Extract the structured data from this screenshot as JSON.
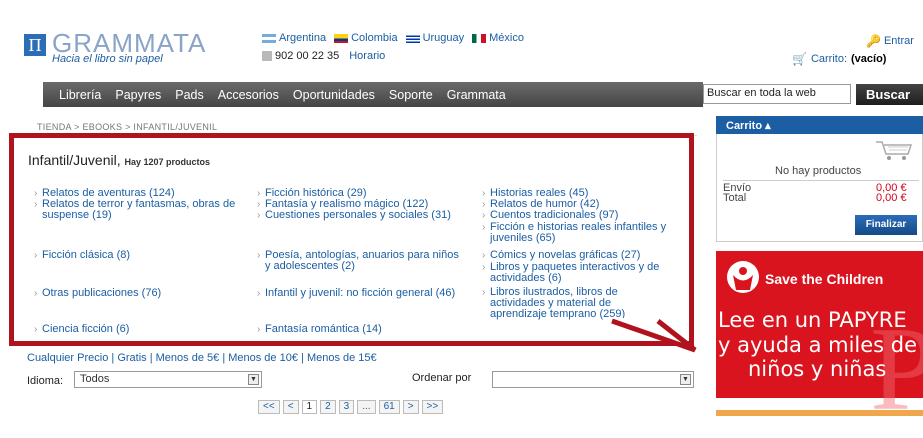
{
  "header": {
    "logo_mark": "Π",
    "logo_text": "GRAMMATA",
    "tagline": "Hacia el libro sin papel",
    "countries": [
      {
        "name": "Argentina",
        "flag_colors": [
          "#74acdf",
          "#ffffff",
          "#74acdf"
        ]
      },
      {
        "name": "Colombia",
        "flag_colors": [
          "#fcd116",
          "#003893",
          "#ce1126"
        ]
      },
      {
        "name": "Uruguay",
        "flag_colors": [
          "#ffffff",
          "#0038a8",
          "#ffffff"
        ]
      },
      {
        "name": "México",
        "flag_colors": [
          "#006847",
          "#ffffff",
          "#ce1126"
        ]
      }
    ],
    "phone": "902 00 22 35",
    "horario": "Horario",
    "entrar": "Entrar",
    "carrito_label": "Carrito:",
    "carrito_status": "(vacío)"
  },
  "nav": {
    "items": [
      "Librería",
      "Papyres",
      "Pads",
      "Accesorios",
      "Oportunidades",
      "Soporte",
      "Grammata"
    ],
    "search_value": "Buscar en toda la web",
    "search_button": "Buscar"
  },
  "breadcrumb": "TIENDA > EBOOKS > INFANTIL/JUVENIL",
  "category": {
    "title": "Infantil/Juvenil,",
    "count": "Hay 1207 productos",
    "col1": [
      "Relatos de aventuras (124)",
      "Relatos de terror y fantasmas, obras de suspense (19)",
      "Ficción clásica (8)",
      "Otras publicaciones (76)",
      "Ciencia ficción (6)"
    ],
    "col2": [
      "Ficción histórica (29)",
      "Fantasía y realismo mágico (122)",
      "Cuestiones personales y sociales (31)",
      "Poesía, antologías, anuarios para niños y adolescentes (2)",
      "Infantil y juvenil: no ficción general (46)",
      "Fantasía romántica (14)"
    ],
    "col3": [
      "Historias reales (45)",
      "Relatos de humor (42)",
      "Cuentos tradicionales (97)",
      "Ficción e historias reales infantiles y juveniles (65)",
      "Cómics y novelas gráficas (27)",
      "Libros y paquetes interactivos y de actividades (6)",
      "Libros ilustrados, libros de actividades y material de aprendizaje temprano (259)"
    ]
  },
  "filters": {
    "prices": [
      "Cualquier Precio",
      "Gratis",
      "Menos de 5€",
      "Menos de 10€",
      "Menos de 15€"
    ],
    "idioma_label": "Idioma:",
    "idioma_value": "Todos",
    "ordenar_label": "Ordenar por",
    "ordenar_value": ""
  },
  "pager": [
    "<<",
    "<",
    "1",
    "2",
    "3",
    "...",
    "61",
    ">",
    ">>"
  ],
  "cart": {
    "title": "Carrito ▴",
    "empty": "No hay productos",
    "envio_label": "Envío",
    "envio_value": "0,00 €",
    "total_label": "Total",
    "total_value": "0,00 €",
    "finalizar": "Finalizar"
  },
  "ad": {
    "brand": "Save the Children",
    "line1": "Lee en un PAPYRE",
    "line2": "y ayuda a miles de",
    "line3": "niños y niñas",
    "big_letter": "P"
  },
  "colors": {
    "accent": "#1b5ea3",
    "callout": "#b0121e",
    "ad_red": "#d9141f"
  }
}
